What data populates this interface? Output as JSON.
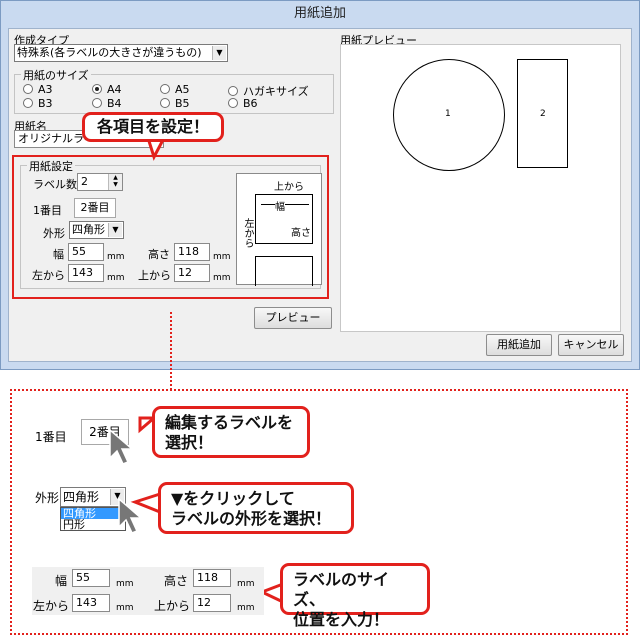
{
  "window": {
    "title": "用紙追加"
  },
  "form": {
    "type_label": "作成タイプ",
    "type_value": "特殊系(各ラベルの大きさが違うもの)",
    "size_group_label": "用紙のサイズ",
    "sizes": [
      "A3",
      "A4",
      "A5",
      "ハガキサイズ",
      "B3",
      "B4",
      "B5",
      "B6"
    ],
    "selected_size": "A4",
    "name_label": "用紙名",
    "name_value": "オリジナルラベ",
    "settings_group_label": "用紙設定",
    "label_count_label": "ラベル数",
    "label_count_value": "2",
    "tab1": "1番目",
    "tab2": "2番目",
    "shape_label": "外形",
    "shape_value": "四角形",
    "width_label": "幅",
    "width_value": "55",
    "height_label": "高さ",
    "height_value": "118",
    "left_label": "左から",
    "left_value": "143",
    "top_label": "上から",
    "top_value": "12",
    "unit": "mm",
    "diagram": {
      "top": "上から",
      "width": "幅",
      "height": "高さ",
      "left": "左から"
    },
    "preview_button": "プレビュー"
  },
  "preview": {
    "label": "用紙プレビュー",
    "shape1_number": "1",
    "shape2_number": "2"
  },
  "buttons": {
    "add": "用紙追加",
    "cancel": "キャンセル"
  },
  "callouts": {
    "set_items": "各項目を設定！",
    "select_label_1": "編集するラベルを",
    "select_label_2": "選択！",
    "shape_1": "▼をクリックして",
    "shape_2": "ラベルの外形を選択！",
    "input_1": "ラベルのサイズ、",
    "input_2": "位置を入力！"
  },
  "zoom": {
    "tab1": "1番目",
    "tab2": "2番目",
    "shape_label": "外形",
    "shape_value": "四角形",
    "options": [
      "四角形",
      "円形"
    ],
    "width_label": "幅",
    "width_value": "55",
    "height_label": "高さ",
    "height_value": "118",
    "left_label": "左から",
    "left_value": "143",
    "top_label": "上から",
    "top_value": "12",
    "unit": "mm"
  },
  "colors": {
    "accent": "#e2211c",
    "titlebar": "#c9daf0",
    "highlight": "#3399ff"
  }
}
